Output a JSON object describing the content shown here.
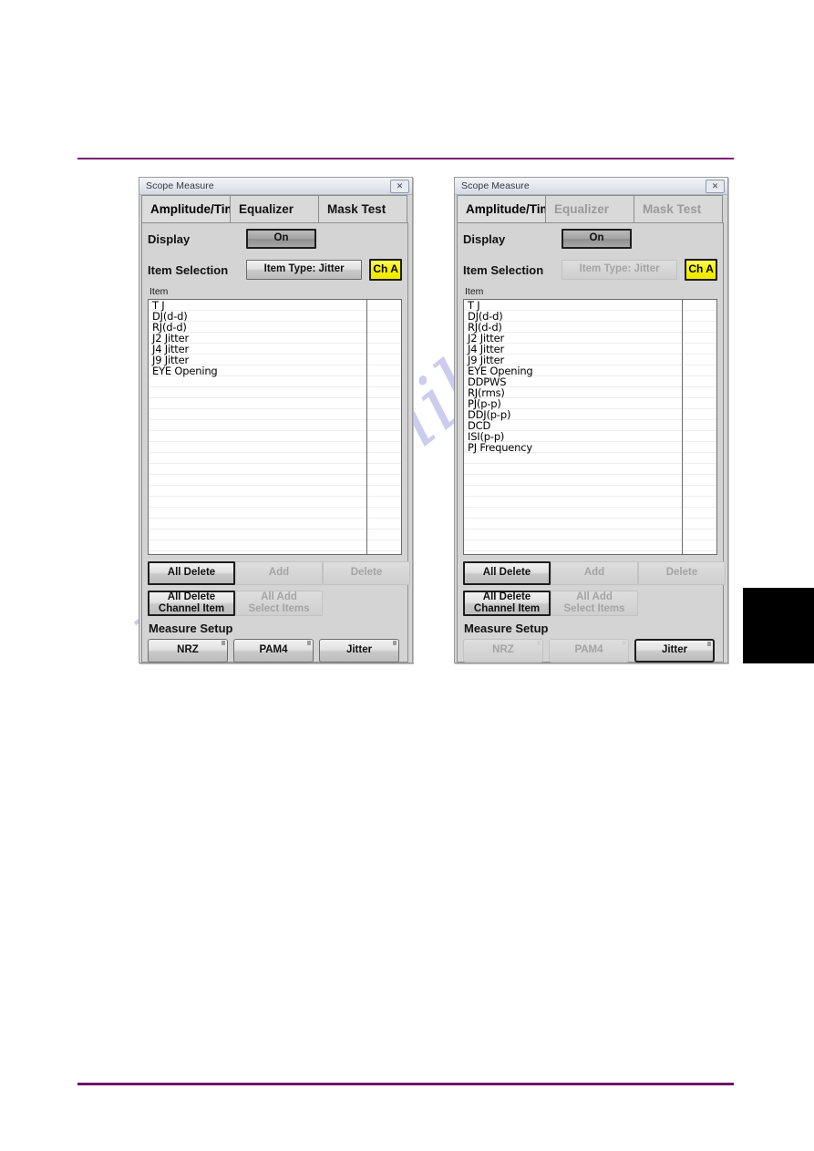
{
  "page": {
    "watermark": "manualslib.com",
    "rule_color": "#7b1770",
    "marker_color": "#000000"
  },
  "panels": [
    {
      "id": "nrz-jitter-panel",
      "titlebar": {
        "title": "Scope Measure",
        "close_icon": "✕"
      },
      "tabs": [
        {
          "label": "Amplitude/Time",
          "active": true,
          "enabled": true
        },
        {
          "label": "Equalizer",
          "active": false,
          "enabled": true
        },
        {
          "label": "Mask Test",
          "active": false,
          "enabled": true
        }
      ],
      "display": {
        "label": "Display",
        "button_label": "On"
      },
      "item_selection": {
        "label": "Item Selection",
        "type_button_label": "Item Type: Jitter",
        "type_button_enabled": true,
        "channel_button_label": "Ch A",
        "channel_color": "#f7f200"
      },
      "list": {
        "caption": "Item",
        "items": [
          "T J",
          "DJ(d-d)",
          "RJ(d-d)",
          "J2  Jitter",
          "J4  Jitter",
          "J9  Jitter",
          "EYE Opening"
        ],
        "side_items": []
      },
      "actions": {
        "all_delete": {
          "label": "All Delete",
          "enabled": true
        },
        "add": {
          "label": "Add",
          "enabled": false
        },
        "delete": {
          "label": "Delete",
          "enabled": false
        },
        "all_delete_channel_item": {
          "label": "All Delete\nChannel Item",
          "enabled": true
        },
        "all_add_select_items": {
          "label": "All Add\nSelect Items",
          "enabled": false
        }
      },
      "measure_setup": {
        "label": "Measure Setup",
        "buttons": [
          {
            "label": "NRZ",
            "enabled": true,
            "selected": false
          },
          {
            "label": "PAM4",
            "enabled": true,
            "selected": false
          },
          {
            "label": "Jitter",
            "enabled": true,
            "selected": false
          }
        ]
      }
    },
    {
      "id": "jitter-only-panel",
      "titlebar": {
        "title": "Scope Measure",
        "close_icon": "✕"
      },
      "tabs": [
        {
          "label": "Amplitude/Time",
          "active": true,
          "enabled": true
        },
        {
          "label": "Equalizer",
          "active": false,
          "enabled": false
        },
        {
          "label": "Mask Test",
          "active": false,
          "enabled": false
        }
      ],
      "display": {
        "label": "Display",
        "button_label": "On"
      },
      "item_selection": {
        "label": "Item Selection",
        "type_button_label": "Item Type: Jitter",
        "type_button_enabled": false,
        "channel_button_label": "Ch A",
        "channel_color": "#f7f200"
      },
      "list": {
        "caption": "Item",
        "items": [
          "T J",
          "DJ(d-d)",
          "RJ(d-d)",
          "J2  Jitter",
          "J4  Jitter",
          "J9  Jitter",
          "EYE Opening",
          "DDPWS",
          "RJ(rms)",
          "PJ(p-p)",
          "DDJ(p-p)",
          "DCD",
          "ISI(p-p)",
          "PJ Frequency"
        ],
        "side_items": []
      },
      "actions": {
        "all_delete": {
          "label": "All Delete",
          "enabled": true
        },
        "add": {
          "label": "Add",
          "enabled": false
        },
        "delete": {
          "label": "Delete",
          "enabled": false
        },
        "all_delete_channel_item": {
          "label": "All Delete\nChannel Item",
          "enabled": true
        },
        "all_add_select_items": {
          "label": "All Add\nSelect Items",
          "enabled": false
        }
      },
      "measure_setup": {
        "label": "Measure Setup",
        "buttons": [
          {
            "label": "NRZ",
            "enabled": false,
            "selected": false
          },
          {
            "label": "PAM4",
            "enabled": false,
            "selected": false
          },
          {
            "label": "Jitter",
            "enabled": true,
            "selected": true
          }
        ]
      }
    }
  ]
}
